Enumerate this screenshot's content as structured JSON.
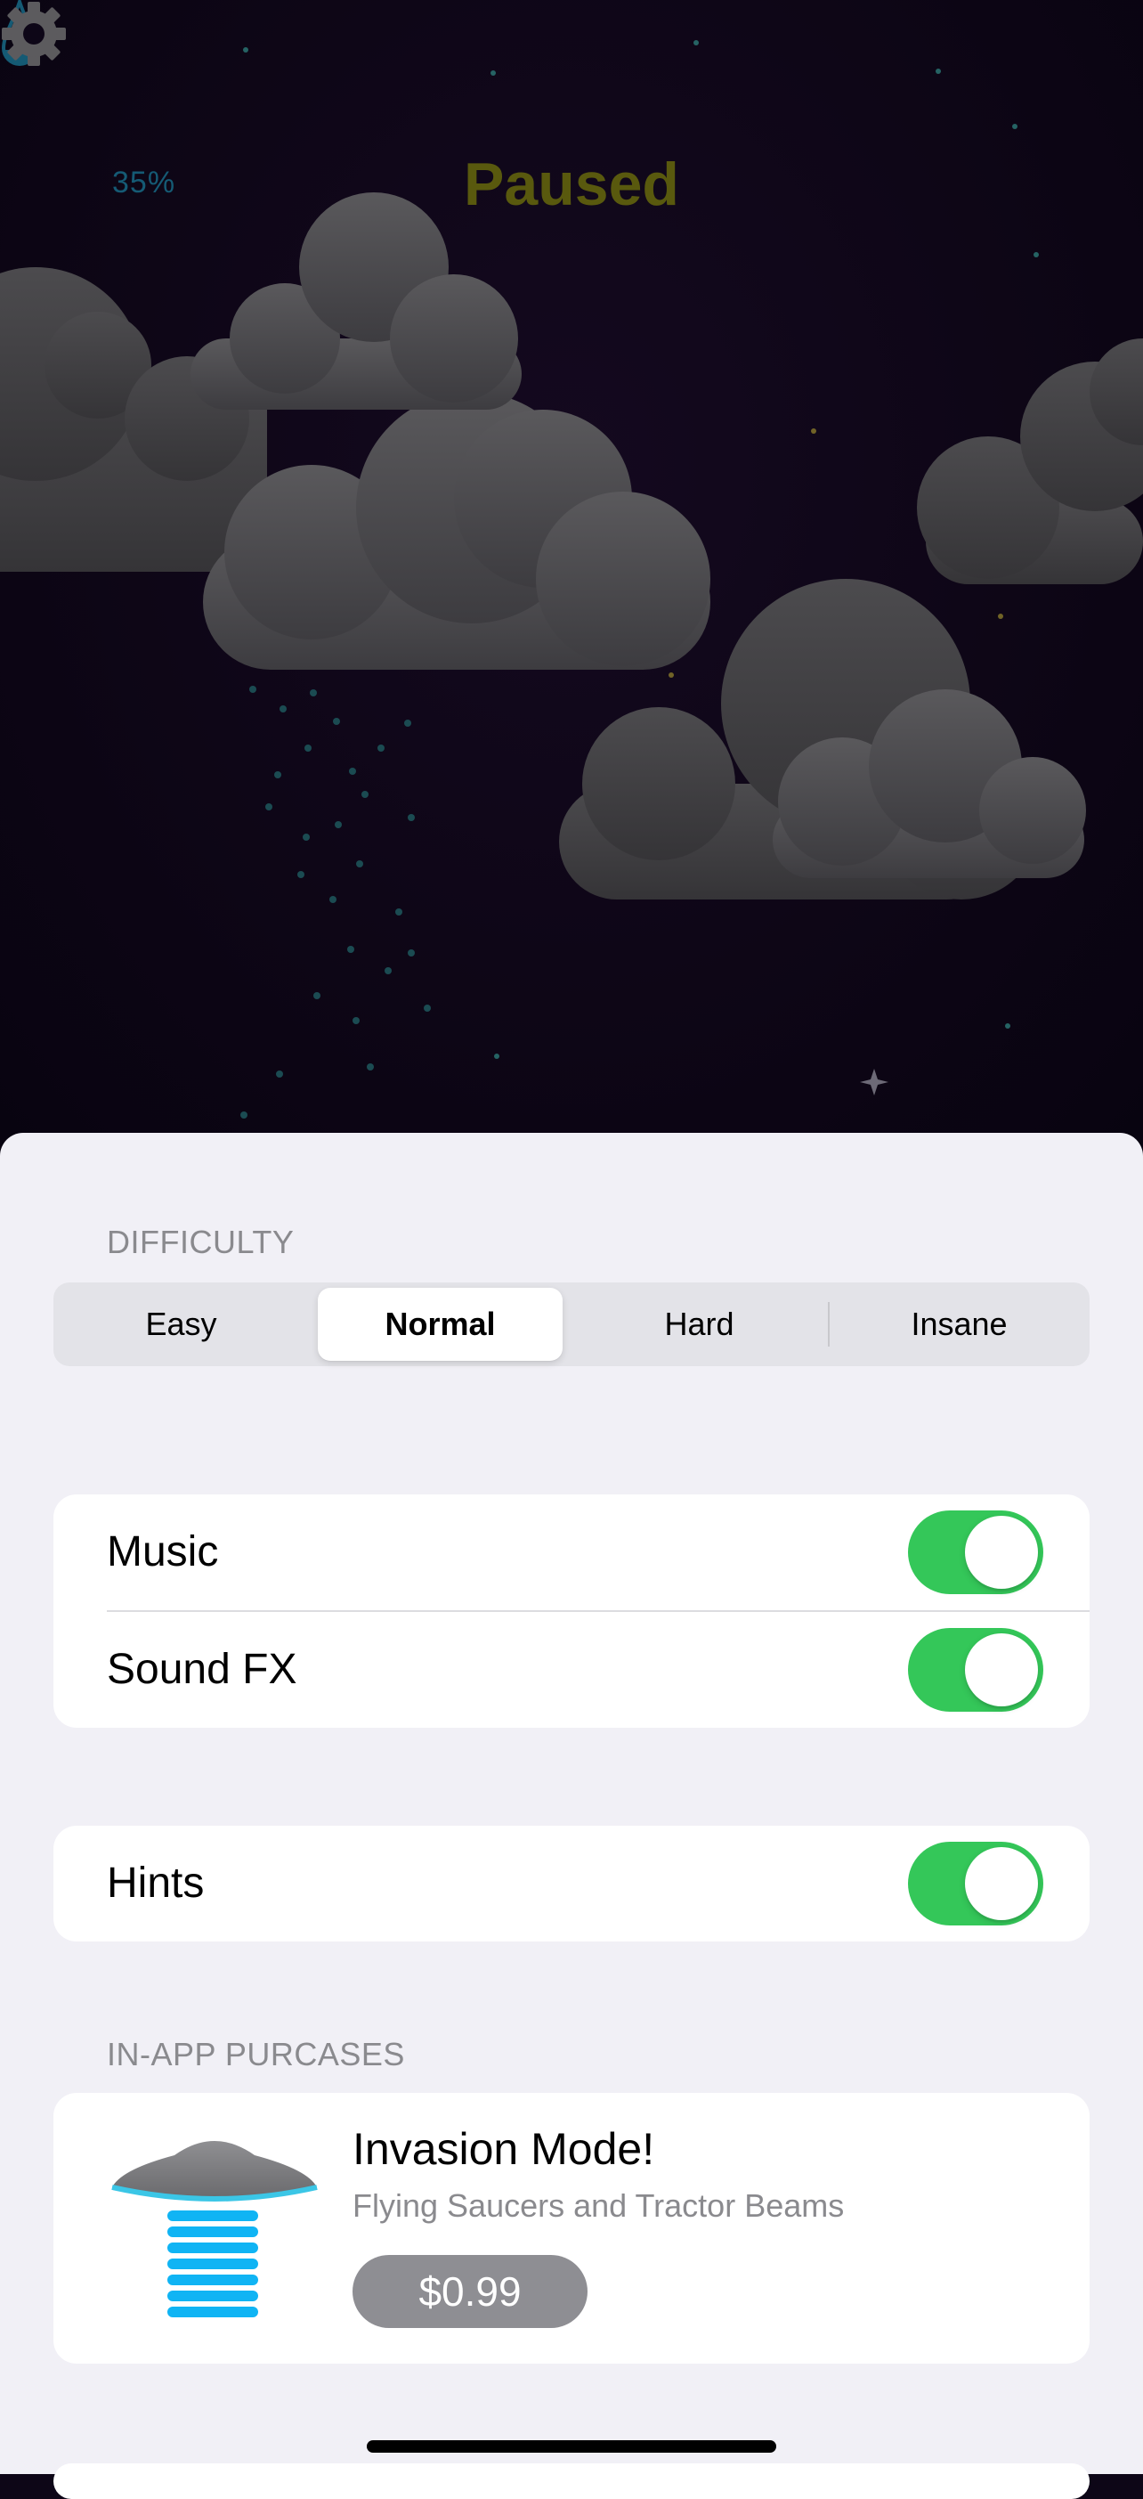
{
  "hud": {
    "water_percent": "35%",
    "status_title": "Paused",
    "water_icon": "water-drop-icon",
    "settings_icon": "gear-icon"
  },
  "difficulty": {
    "section_label": "DIFFICULTY",
    "options": [
      "Easy",
      "Normal",
      "Hard",
      "Insane"
    ],
    "selected": "Normal"
  },
  "audio_group": {
    "music_label": "Music",
    "music_on": true,
    "sound_fx_label": "Sound FX",
    "sound_fx_on": true
  },
  "hints_group": {
    "hints_label": "Hints",
    "hints_on": true
  },
  "iap": {
    "section_label": "IN-APP PURCASES",
    "item_title": "Invasion Mode!",
    "item_subtitle": "Flying Saucers and Tractor Beams",
    "price": "$0.99",
    "item_icon": "flying-saucer-icon"
  },
  "colors": {
    "toggle_on": "#34c759",
    "title_color": "#59590e",
    "percent_color": "#155a74",
    "sheet_background": "#f1f0f6",
    "price_button": "#8e8e93"
  }
}
